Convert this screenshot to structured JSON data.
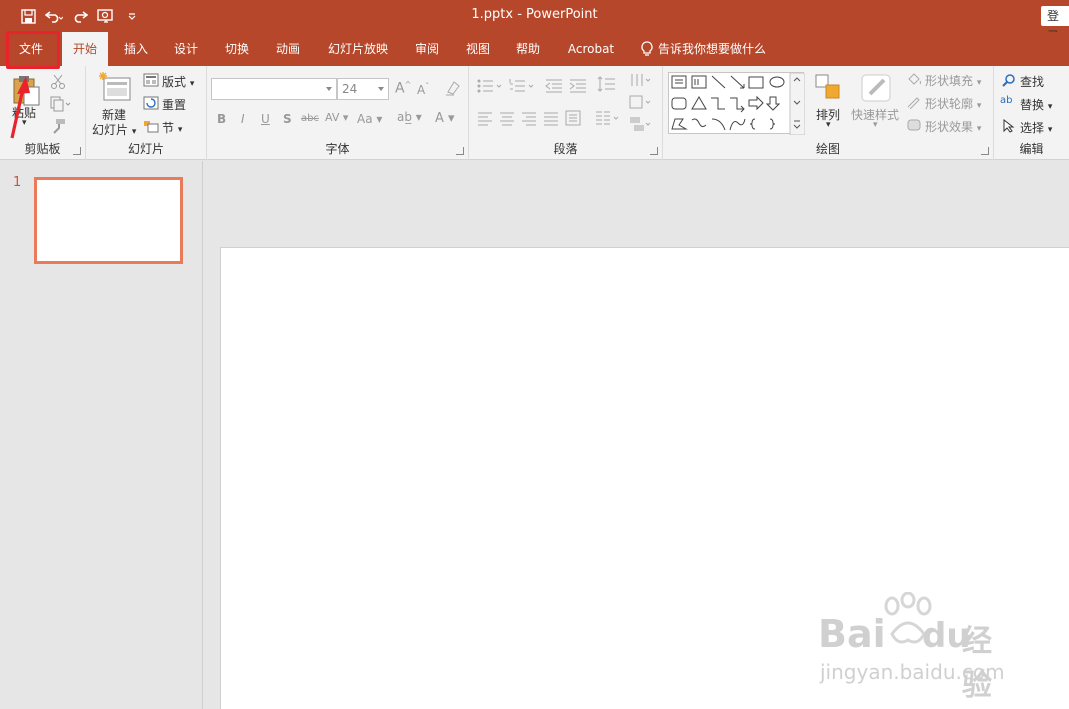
{
  "window": {
    "title": "1.pptx  -  PowerPoint",
    "login_label": "登录"
  },
  "tabs": [
    {
      "label": "文件"
    },
    {
      "label": "开始"
    },
    {
      "label": "插入"
    },
    {
      "label": "设计"
    },
    {
      "label": "切换"
    },
    {
      "label": "动画"
    },
    {
      "label": "幻灯片放映"
    },
    {
      "label": "审阅"
    },
    {
      "label": "视图"
    },
    {
      "label": "帮助"
    },
    {
      "label": "Acrobat"
    }
  ],
  "tell_me": "告诉我你想要做什么",
  "ribbon": {
    "clipboard": {
      "label": "剪贴板",
      "paste": "粘贴"
    },
    "slides": {
      "label": "幻灯片",
      "new_slide_1": "新建",
      "new_slide_2": "幻灯片",
      "layout": "版式",
      "reset": "重置",
      "section": "节"
    },
    "font": {
      "label": "字体",
      "font_name": "",
      "font_size": "24"
    },
    "paragraph": {
      "label": "段落"
    },
    "drawing": {
      "label": "绘图",
      "arrange": "排列",
      "quick_styles": "快速样式",
      "shape_fill": "形状填充",
      "shape_outline": "形状轮廓",
      "shape_effects": "形状效果"
    },
    "editing": {
      "label": "编辑",
      "find": "查找",
      "replace": "替换",
      "select": "选择"
    }
  },
  "thumbnails": [
    {
      "number": "1"
    }
  ],
  "watermark": {
    "brand": "Bai",
    "brand2": "du",
    "brand3": "经验",
    "url": "jingyan.baidu.com"
  },
  "colors": {
    "accent": "#b7472a",
    "highlight": "#e8232c"
  }
}
